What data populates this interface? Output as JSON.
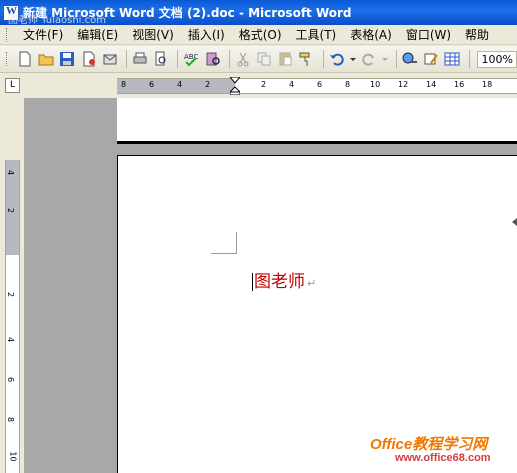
{
  "window": {
    "title": "新建 Microsoft Word 文档 (2).doc - Microsoft Word",
    "watermark": "图老师 Tulaoshi.com"
  },
  "menu": {
    "items": [
      {
        "label": "文件(F)"
      },
      {
        "label": "编辑(E)"
      },
      {
        "label": "视图(V)"
      },
      {
        "label": "插入(I)"
      },
      {
        "label": "格式(O)"
      },
      {
        "label": "工具(T)"
      },
      {
        "label": "表格(A)"
      },
      {
        "label": "窗口(W)"
      },
      {
        "label": "帮助"
      }
    ]
  },
  "toolbar": {
    "zoom": "100%",
    "icons": [
      "new-icon",
      "open-icon",
      "save-icon",
      "permission-icon",
      "email-icon",
      "print-icon",
      "print-preview-icon",
      "spelling-icon",
      "research-icon",
      "cut-icon",
      "copy-icon",
      "paste-icon",
      "format-painter-icon",
      "undo-icon",
      "redo-icon",
      "hyperlink-icon",
      "drawing-icon",
      "table-icon"
    ]
  },
  "ruler": {
    "tab_selector": "L",
    "horizontal_numbers": [
      "8",
      "6",
      "4",
      "2",
      "2",
      "4",
      "6",
      "8",
      "10",
      "12",
      "14",
      "16",
      "18"
    ],
    "vertical_numbers": [
      "4",
      "2",
      "2",
      "4",
      "6",
      "8",
      "10"
    ]
  },
  "document": {
    "text": "图老师",
    "text_color": "#c00000"
  },
  "branding": {
    "name": "Office教程学习网",
    "url": "www.office68.com"
  }
}
